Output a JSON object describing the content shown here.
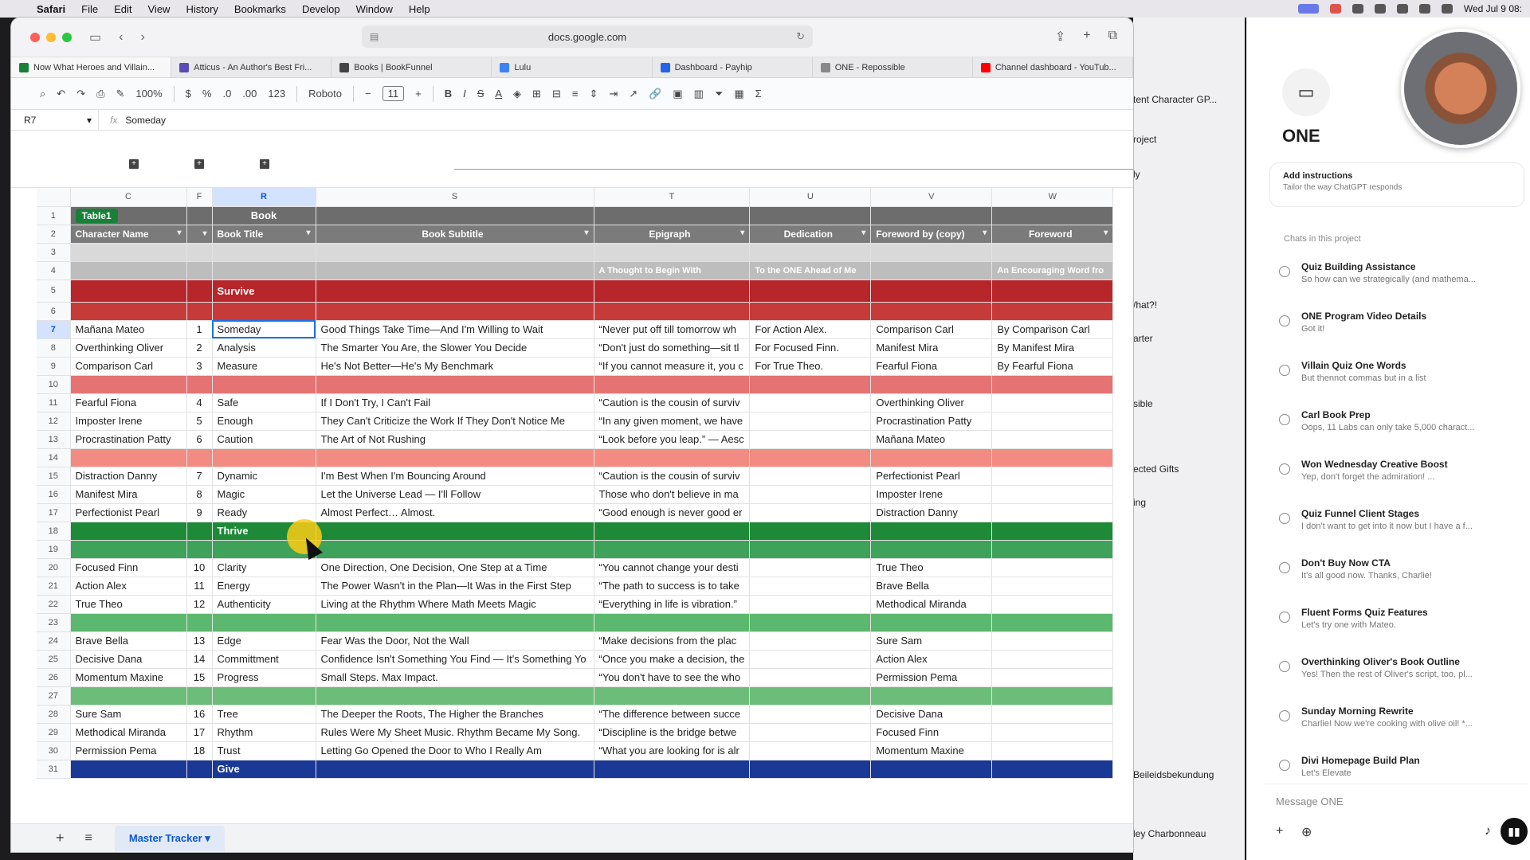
{
  "menubar": {
    "app": "Safari",
    "items": [
      "File",
      "Edit",
      "View",
      "History",
      "Bookmarks",
      "Develop",
      "Window",
      "Help"
    ],
    "clock": "Wed Jul 9  08:"
  },
  "browser": {
    "url": "docs.google.com",
    "tabs": [
      {
        "label": "Now What Heroes and Villain...",
        "color": "#188038"
      },
      {
        "label": "Atticus - An Author's Best Fri...",
        "color": "#5b4bb7"
      },
      {
        "label": "Books | BookFunnel",
        "color": "#444444"
      },
      {
        "label": "Lulu",
        "color": "#3b82f6"
      },
      {
        "label": "Dashboard - Payhip",
        "color": "#2563eb"
      },
      {
        "label": "ONE - Repossible",
        "color": "#888888"
      },
      {
        "label": "Channel dashboard - YouTub...",
        "color": "#ff0000"
      }
    ]
  },
  "sheets": {
    "zoom": "100%",
    "currency": "$",
    "percent": "%",
    "dec_dec": ".0",
    "dec_inc": ".00",
    "num_fmt": "123",
    "font": "Roboto",
    "font_size": "11",
    "name_box": "R7",
    "formula_value": "Someday",
    "columns": [
      "C",
      "F",
      "R",
      "S",
      "T",
      "U",
      "V",
      "W"
    ],
    "table_chip": "Table1",
    "row1_label": "Book",
    "headers": [
      "Character Name",
      "",
      "Book Title",
      "Book Subtitle",
      "Epigraph",
      "Dedication",
      "Foreword by (copy)",
      "Foreword"
    ],
    "row4": [
      "",
      "",
      "",
      "",
      "A Thought to Begin With",
      "To the ONE Ahead of Me",
      "",
      "An Encouraging Word fro"
    ],
    "sections": {
      "survive": "Survive",
      "thrive": "Thrive",
      "give": "Give"
    },
    "rows": [
      {
        "n": "7",
        "c": [
          "Mañana Mateo",
          "1",
          "Someday",
          "Good Things Take Time—And I'm Willing to Wait",
          "“Never put off till tomorrow wh",
          "For Action Alex.",
          "Comparison Carl",
          "By Comparison Carl"
        ]
      },
      {
        "n": "8",
        "c": [
          "Overthinking Oliver",
          "2",
          "Analysis",
          "The Smarter You Are, the Slower You Decide",
          "“Don't just do something—sit tl",
          "For Focused Finn.",
          "Manifest Mira",
          "By Manifest Mira"
        ]
      },
      {
        "n": "9",
        "c": [
          "Comparison Carl",
          "3",
          "Measure",
          "He's Not Better—He's My Benchmark",
          "“If you cannot measure it, you c",
          "For True Theo.",
          "Fearful Fiona",
          "By Fearful Fiona"
        ]
      },
      {
        "n": "11",
        "c": [
          "Fearful Fiona",
          "4",
          "Safe",
          "If I Don't Try, I Can't Fail",
          "“Caution is the cousin of surviv",
          "",
          "Overthinking Oliver",
          ""
        ]
      },
      {
        "n": "12",
        "c": [
          "Imposter Irene",
          "5",
          "Enough",
          "They Can't Criticize the Work If They Don't Notice Me",
          "“In any given moment, we have",
          "",
          "Procrastination Patty",
          ""
        ]
      },
      {
        "n": "13",
        "c": [
          "Procrastination Patty",
          "6",
          "Caution",
          "The Art of Not Rushing",
          "“Look before you leap.” — Aesc",
          "",
          "Mañana Mateo",
          ""
        ]
      },
      {
        "n": "15",
        "c": [
          "Distraction Danny",
          "7",
          "Dynamic",
          "I'm Best When I'm Bouncing Around",
          "“Caution is the cousin of surviv",
          "",
          "Perfectionist Pearl",
          ""
        ]
      },
      {
        "n": "16",
        "c": [
          "Manifest Mira",
          "8",
          "Magic",
          "Let the Universe Lead — I'll Follow",
          "Those who don't believe in ma",
          "",
          "Imposter Irene",
          ""
        ]
      },
      {
        "n": "17",
        "c": [
          "Perfectionist Pearl",
          "9",
          "Ready",
          "Almost Perfect… Almost.",
          "“Good enough is never good er",
          "",
          "Distraction Danny",
          ""
        ]
      },
      {
        "n": "20",
        "c": [
          "Focused Finn",
          "10",
          "Clarity",
          "One Direction, One Decision, One Step at a Time",
          "“You cannot change your desti",
          "",
          "True Theo",
          ""
        ]
      },
      {
        "n": "21",
        "c": [
          "Action Alex",
          "11",
          "Energy",
          "The Power Wasn't in the Plan—It Was in the First Step",
          "“The path to success is to take",
          "",
          "Brave Bella",
          ""
        ]
      },
      {
        "n": "22",
        "c": [
          "True Theo",
          "12",
          "Authenticity",
          "Living at the Rhythm Where Math Meets Magic",
          "“Everything in life is vibration.”",
          "",
          "Methodical Miranda",
          ""
        ]
      },
      {
        "n": "24",
        "c": [
          "Brave Bella",
          "13",
          "Edge",
          "Fear Was the Door, Not the Wall",
          "“Make decisions from the plac",
          "",
          "Sure Sam",
          ""
        ]
      },
      {
        "n": "25",
        "c": [
          "Decisive Dana",
          "14",
          "Committment",
          "Confidence Isn't Something You Find — It's Something Yo",
          "“Once you make a decision, the",
          "",
          "Action Alex",
          ""
        ]
      },
      {
        "n": "26",
        "c": [
          "Momentum Maxine",
          "15",
          "Progress",
          "Small Steps. Max Impact.",
          "“You don't have to see the who",
          "",
          "Permission Pema",
          ""
        ]
      },
      {
        "n": "28",
        "c": [
          "Sure Sam",
          "16",
          "Tree",
          "The Deeper the Roots, The Higher the Branches",
          "“The difference between succe",
          "",
          "Decisive Dana",
          ""
        ]
      },
      {
        "n": "29",
        "c": [
          "Methodical Miranda",
          "17",
          "Rhythm",
          "Rules Were My Sheet Music. Rhythm Became My Song.",
          "“Discipline is the bridge betwe",
          "",
          "Focused Finn",
          ""
        ]
      },
      {
        "n": "30",
        "c": [
          "Permission Pema",
          "18",
          "Trust",
          "Letting Go Opened the Door to Who I Really Am",
          "“What you are looking for is alr",
          "",
          "Momentum Maxine",
          ""
        ]
      }
    ],
    "sheet_tab": "Master Tracker"
  },
  "finder": {
    "items": [
      "tent Character GP...",
      "roject",
      "ly",
      "/hat?!",
      "arter",
      "sible",
      "ected Gifts",
      "ing",
      "Beileidsbekundung",
      "ley Charbonneau"
    ]
  },
  "chat": {
    "project": "ONE",
    "instructions_title": "Add instructions",
    "instructions_sub": "Tailor the way ChatGPT responds",
    "chats_header": "Chats in this project",
    "items": [
      {
        "title": "Quiz Building Assistance",
        "preview": "So how can we strategically (and mathema..."
      },
      {
        "title": "ONE Program Video Details",
        "preview": "Got it!"
      },
      {
        "title": "Villain Quiz One Words",
        "preview": "But thennot commas but in a list"
      },
      {
        "title": "Carl Book Prep",
        "preview": "Oops, 11 Labs can only take 5,000 charact..."
      },
      {
        "title": "Won Wednesday Creative Boost",
        "preview": "Yep, don't forget the admiration! ..."
      },
      {
        "title": "Quiz Funnel Client Stages",
        "preview": "I don't want to get into it now but I have a f..."
      },
      {
        "title": "Don't Buy Now CTA",
        "preview": "It's all good now. Thanks, Charlie!"
      },
      {
        "title": "Fluent Forms Quiz Features",
        "preview": "Let's try one with Mateo."
      },
      {
        "title": "Overthinking Oliver's Book Outline",
        "preview": "Yes! Then the rest of Oliver's script, too, pl..."
      },
      {
        "title": "Sunday Morning Rewrite",
        "preview": "Charlie! Now we're cooking with olive oil! *..."
      },
      {
        "title": "Divi Homepage Build Plan",
        "preview": "Let's Elevate"
      }
    ],
    "message_placeholder": "Message ONE"
  }
}
